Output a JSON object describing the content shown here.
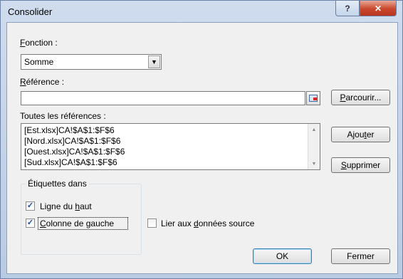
{
  "window": {
    "title": "Consolider",
    "help_glyph": "?",
    "close_glyph": "✕"
  },
  "function": {
    "label_prefix": "F",
    "label_rest": "onction :",
    "selected": "Somme",
    "arrow_glyph": "▼"
  },
  "reference": {
    "label_prefix": "R",
    "label_rest": "éférence :",
    "value": "",
    "browse_prefix": "P",
    "browse_rest": "arcourir..."
  },
  "all_refs": {
    "label": "Toutes les références :",
    "items": [
      "[Est.xlsx]CA!$A$1:$F$6",
      "[Nord.xlsx]CA!$A$1:$F$6",
      "[Ouest.xlsx]CA!$A$1:$F$6",
      "[Sud.xlsx]CA!$A$1:$F$6"
    ],
    "scroll_up": "▲",
    "scroll_down": "▼"
  },
  "buttons": {
    "add_a": "Ajou",
    "add_u": "t",
    "add_b": "er",
    "delete_u": "S",
    "delete_rest": "upprimer",
    "ok": "OK",
    "close": "Fermer"
  },
  "labels_group": {
    "title": "Étiquettes dans",
    "top_row_a": "Ligne du ",
    "top_row_u": "h",
    "top_row_b": "aut",
    "left_col_u": "C",
    "left_col_rest": "olonne de gauche",
    "top_row_checked": "✓",
    "left_col_checked": "✓"
  },
  "link": {
    "label_a": "Lier aux ",
    "label_u": "d",
    "label_b": "onnées source",
    "checked": ""
  }
}
